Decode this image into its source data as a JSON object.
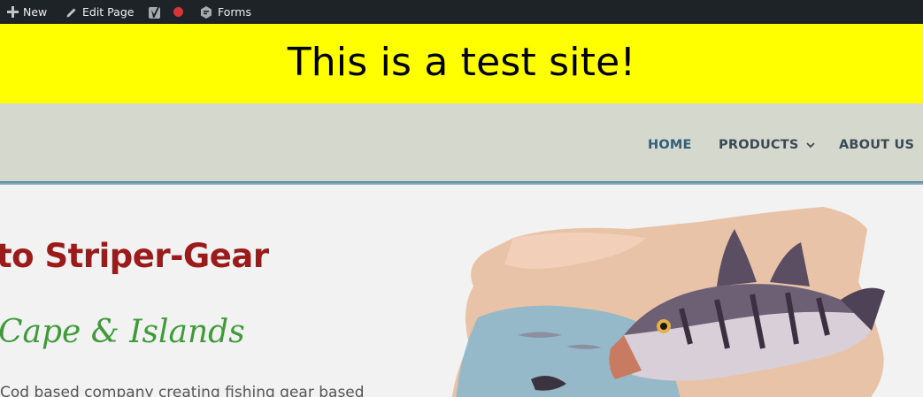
{
  "admin_bar": {
    "new_label": "New",
    "edit_page_label": "Edit Page",
    "forms_label": "Forms",
    "record_color": "#d63638",
    "icons": [
      "plus-icon",
      "pencil-icon",
      "yoast-icon",
      "record-dot-icon",
      "gravity-forms-icon"
    ]
  },
  "banner": {
    "text": "This is a test site!",
    "background": "#ffff00"
  },
  "nav": {
    "items": [
      {
        "label": "HOME",
        "active": true
      },
      {
        "label": "PRODUCTS",
        "has_dropdown": true
      },
      {
        "label": "ABOUT US"
      }
    ],
    "active_color": "#2f5f7a",
    "color": "#3a4a55"
  },
  "hero": {
    "title": "to Striper-Gear",
    "title_color": "#9b1b1b",
    "subtitle": "Cape & Islands",
    "subtitle_color": "#3f9a3a",
    "body": "Cod based company creating fishing gear based"
  },
  "image": {
    "subject": "striped-bass-painting-icon"
  }
}
